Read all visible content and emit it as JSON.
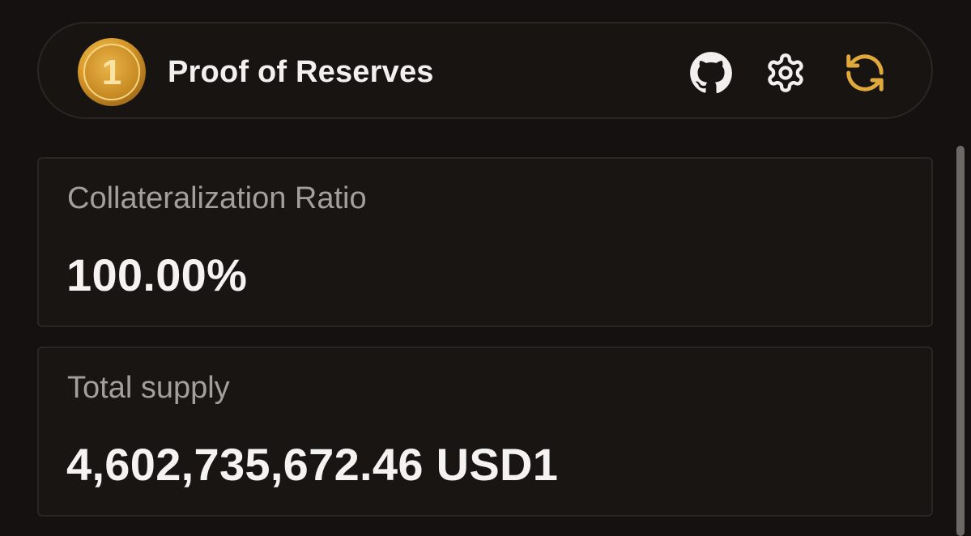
{
  "header": {
    "logo_text": "1",
    "title": "Proof of Reserves",
    "icons": {
      "github": "github-icon",
      "settings": "gear-icon",
      "refresh": "refresh-icon"
    }
  },
  "cards": [
    {
      "label": "Collateralization Ratio",
      "value": "100.00%"
    },
    {
      "label": "Total supply",
      "value": "4,602,735,672.46 USD1"
    }
  ],
  "colors": {
    "background": "#141110",
    "accent_gold": "#e0a93c",
    "text_primary": "#f5f3f1",
    "text_secondary": "#a39f9b",
    "border": "#2a2623"
  }
}
